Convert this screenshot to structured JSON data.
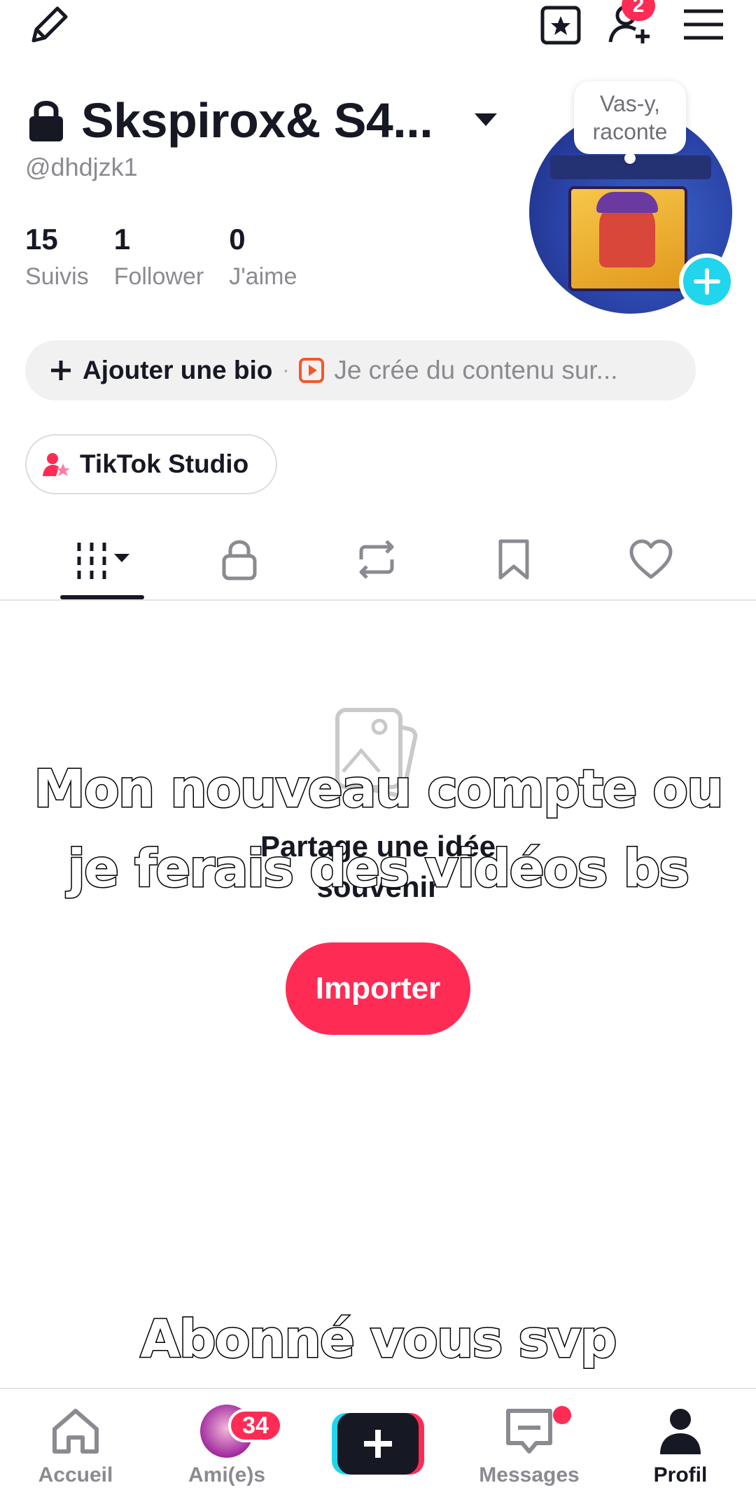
{
  "profile": {
    "display_name": "Skspirox& S4...",
    "handle": "@dhdjzk1",
    "stats": [
      {
        "value": "15",
        "label": "Suivis"
      },
      {
        "value": "1",
        "label": "Follower"
      },
      {
        "value": "0",
        "label": "J'aime"
      }
    ],
    "bubble_text_1": "Vas-y,",
    "bubble_text_2": "raconte"
  },
  "topbar": {
    "friend_requests_badge": "2"
  },
  "bio": {
    "add_label": "Ajouter une bio",
    "separator": "·",
    "suggestion": "Je crée du contenu sur..."
  },
  "studio": {
    "label": "TikTok Studio"
  },
  "empty_state": {
    "line1": "Partage une idée",
    "line2": "souvenir",
    "import_label": "Importer"
  },
  "overlay_text": {
    "line1": "Mon nouveau compte ou",
    "line2": "je ferais des vidéos bs",
    "bottom": "Abonné vous svp"
  },
  "bottom_nav": {
    "home": "Accueil",
    "friends": "Ami(e)s",
    "friends_badge": "34",
    "messages": "Messages",
    "profile": "Profil"
  },
  "colors": {
    "accent_red": "#fe2c55",
    "accent_cyan": "#20d5ec",
    "text_dark": "#161823",
    "text_gray": "#8a8b91"
  }
}
